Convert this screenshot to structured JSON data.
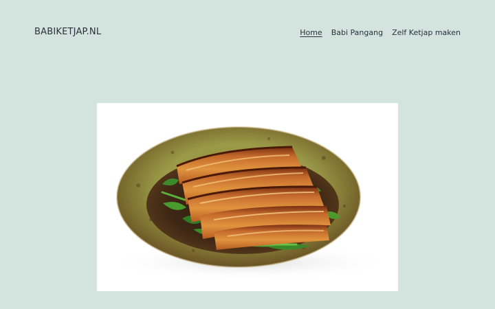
{
  "site": {
    "title": "BABIKETJAP.NL"
  },
  "nav": {
    "items": [
      {
        "label": "Home",
        "current": true
      },
      {
        "label": "Babi Pangang",
        "current": false
      },
      {
        "label": "Zelf Ketjap maken",
        "current": false
      }
    ]
  },
  "featured": {
    "image_subject": "braised-pork-belly-dish",
    "colors": {
      "background": "#d2e4dd",
      "text": "#28303d"
    }
  }
}
